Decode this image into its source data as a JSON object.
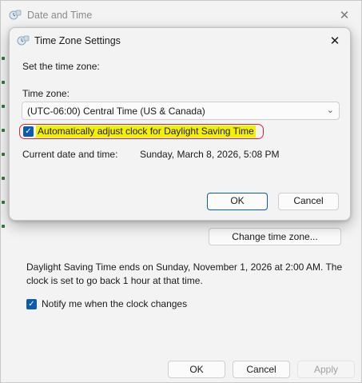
{
  "parent_window": {
    "title": "Date and Time",
    "change_time_zone_label": "Change time zone...",
    "dst_note": "Daylight Saving Time ends on Sunday, November 1, 2026 at 2:00 AM. The clock is set to go back 1 hour at that time.",
    "notify_label": "Notify me when the clock changes",
    "notify_checked": true,
    "buttons": {
      "ok": "OK",
      "cancel": "Cancel",
      "apply": "Apply"
    },
    "apply_enabled": false
  },
  "dialog": {
    "title": "Time Zone Settings",
    "set_time_zone_label": "Set the time zone:",
    "time_zone_label": "Time zone:",
    "time_zone_value": "(UTC-06:00) Central Time (US & Canada)",
    "auto_dst_label": "Automatically adjust clock for Daylight Saving Time",
    "auto_dst_checked": true,
    "current_label": "Current date and time:",
    "current_value": "Sunday, March 8, 2026, 5:08 PM",
    "buttons": {
      "ok": "OK",
      "cancel": "Cancel"
    }
  },
  "icons": {
    "window_icon": "clock-globe-icon",
    "close": "close-icon",
    "dropdown": "chevron-down-icon",
    "check": "checkmark-icon"
  },
  "colors": {
    "accent": "#0b5cad",
    "highlight": "#f4f000",
    "annotation": "#e0242b"
  }
}
